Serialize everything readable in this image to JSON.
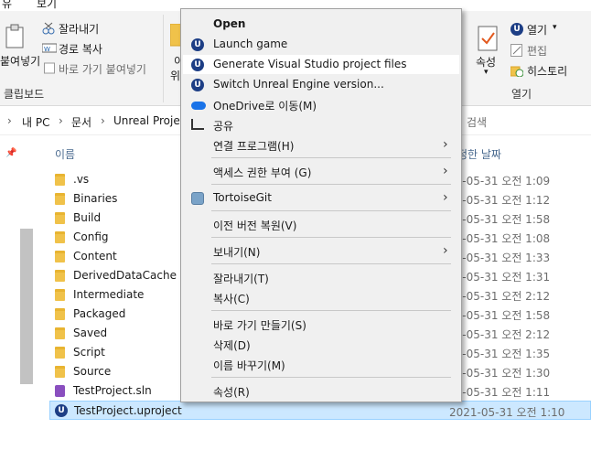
{
  "menubar": {
    "items": [
      "유",
      "보기"
    ]
  },
  "ribbon": {
    "paste_label": "붙여넣기",
    "cut": "잘라내기",
    "copy_path": "경로 복사",
    "paste_shortcut": "바로 가기 붙여넣기",
    "clipboard_group": "클립보드",
    "partial_label": "이",
    "partial_label2": "위",
    "properties": "속성",
    "open": "열기",
    "edit": "편집",
    "history": "히스토리",
    "open_group": "열기"
  },
  "address": {
    "crumbs": [
      "내 PC",
      "문서",
      "Unreal Project"
    ],
    "search_placeholder": "검색"
  },
  "columns": {
    "name": "이름",
    "modified": "정한 날짜"
  },
  "files": [
    {
      "name": ".vs",
      "date": "21-05-31 오전 1:09",
      "icon": "folder-icon"
    },
    {
      "name": "Binaries",
      "date": "21-05-31 오전 1:12",
      "icon": "folder-icon"
    },
    {
      "name": "Build",
      "date": "21-05-31 오전 1:58",
      "icon": "folder-icon"
    },
    {
      "name": "Config",
      "date": "21-05-31 오전 1:08",
      "icon": "folder-icon"
    },
    {
      "name": "Content",
      "date": "21-05-31 오전 1:33",
      "icon": "folder-icon"
    },
    {
      "name": "DerivedDataCache",
      "date": "21-05-31 오전 1:31",
      "icon": "folder-icon"
    },
    {
      "name": "Intermediate",
      "date": "21-05-31 오전 2:12",
      "icon": "folder-icon"
    },
    {
      "name": "Packaged",
      "date": "21-05-31 오전 1:58",
      "icon": "folder-icon"
    },
    {
      "name": "Saved",
      "date": "21-05-31 오전 2:12",
      "icon": "folder-icon"
    },
    {
      "name": "Script",
      "date": "21-05-31 오전 1:35",
      "icon": "folder-icon"
    },
    {
      "name": "Source",
      "date": "21-05-31 오전 1:30",
      "icon": "folder-icon"
    },
    {
      "name": "TestProject.sln",
      "date": "21-05-31 오전 1:11",
      "icon": "visual-studio-solution-icon"
    },
    {
      "name": "TestProject.uproject",
      "date": "2021-05-31 오전 1:10",
      "icon": "unreal-engine-icon"
    }
  ],
  "context_menu": {
    "items": [
      {
        "label": "Open",
        "bold": true
      },
      {
        "label": "Launch game",
        "icon": "unreal-engine-icon"
      },
      {
        "label": "Generate Visual Studio project files",
        "icon": "unreal-engine-icon",
        "highlighted": true
      },
      {
        "label": "Switch Unreal Engine version...",
        "icon": "unreal-engine-icon"
      },
      {
        "label": "OneDrive로 이동(M)",
        "icon": "onedrive-cloud-icon"
      },
      {
        "label": "공유",
        "icon": "share-icon"
      },
      {
        "label": "연결 프로그램(H)",
        "submenu": true
      },
      {
        "label": "액세스 권한 부여 (G)",
        "submenu": true
      },
      {
        "label": "TortoiseGit",
        "icon": "tortoisegit-icon",
        "submenu": true
      },
      {
        "label": "이전 버전 복원(V)"
      },
      {
        "label": "보내기(N)",
        "submenu": true
      },
      {
        "label": "잘라내기(T)"
      },
      {
        "label": "복사(C)"
      },
      {
        "label": "바로 가기 만들기(S)"
      },
      {
        "label": "삭제(D)"
      },
      {
        "label": "이름 바꾸기(M)"
      },
      {
        "label": "속성(R)"
      }
    ]
  },
  "colors": {
    "selection": "#cce8ff",
    "accent": "#1d3e85"
  }
}
